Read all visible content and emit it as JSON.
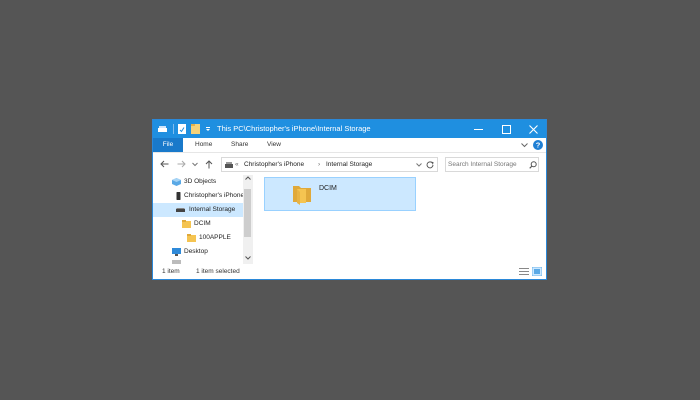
{
  "window": {
    "title": "This PC\\Christopher's iPhone\\Internal Storage"
  },
  "ribbon": {
    "tabs": [
      {
        "label": "File"
      },
      {
        "label": "Home"
      },
      {
        "label": "Share"
      },
      {
        "label": "View"
      }
    ]
  },
  "address": {
    "overflow": "«",
    "segments": [
      "Christopher's iPhone",
      "Internal Storage"
    ],
    "separator": "›"
  },
  "search": {
    "placeholder": "Search Internal Storage"
  },
  "nav": {
    "items": [
      {
        "label": "3D Objects",
        "icon": "3d-objects-icon"
      },
      {
        "label": "Christopher's iPhone",
        "icon": "phone-icon"
      },
      {
        "label": "Internal Storage",
        "icon": "drive-icon",
        "selected": true
      },
      {
        "label": "DCIM",
        "icon": "folder-icon"
      },
      {
        "label": "100APPLE",
        "icon": "folder-icon"
      },
      {
        "label": "Desktop",
        "icon": "desktop-icon"
      }
    ]
  },
  "content": {
    "items": [
      {
        "name": "DCIM",
        "type": "folder",
        "selected": true
      }
    ]
  },
  "status": {
    "item_count": "1 item",
    "selection": "1 item selected"
  },
  "colors": {
    "titlebar": "#1f8fe0",
    "file_tab": "#1979ca",
    "selection": "#cce8ff",
    "folder": "#f5c451",
    "background": "#555555"
  }
}
